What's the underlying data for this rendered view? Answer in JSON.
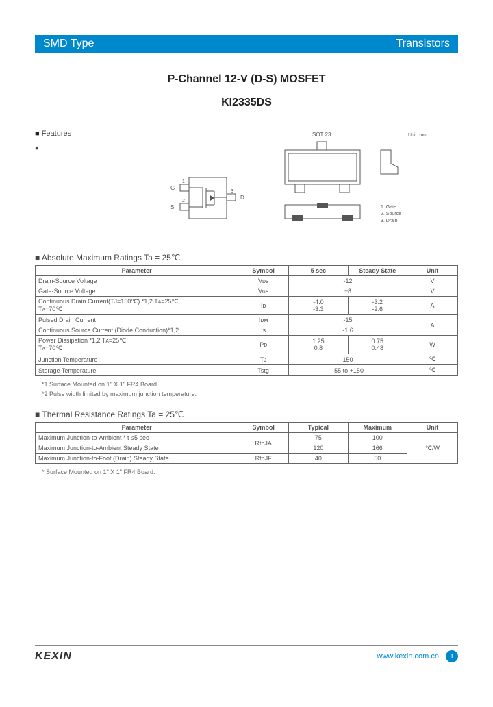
{
  "header": {
    "category": "SMD Type",
    "family": "Transistors"
  },
  "title": {
    "line1": "P-Channel 12-V (D-S) MOSFET",
    "part": "KI2335DS"
  },
  "features": {
    "heading": "Features"
  },
  "package": {
    "label": "SOT 23",
    "unitnote": "Unit: mm",
    "pins": {
      "p1": "1. Gate",
      "p2": "2. Source",
      "p3": "3. Drain"
    },
    "pinlabels": {
      "g": "G",
      "s": "S",
      "d": "D",
      "n1": "1",
      "n2": "2",
      "n3": "3"
    }
  },
  "abs": {
    "heading": "Absolute Maximum Ratings Ta = 25℃",
    "cols": {
      "param": "Parameter",
      "sym": "Symbol",
      "c5": "5 sec",
      "ss": "Steady State",
      "unit": "Unit"
    },
    "rows": [
      {
        "param": "Drain-Source Voltage",
        "sym": "Vᴅs",
        "c5": "",
        "val": "-12",
        "unit": "V",
        "merge": true
      },
      {
        "param": "Gate-Source Voltage",
        "sym": "Vɢs",
        "c5": "",
        "val": "±8",
        "unit": "V",
        "merge": true
      },
      {
        "param": "Continuous Drain Current(TJ=150℃) *1,2 Tᴀ=25℃\n                                                                          Tᴀ=70℃",
        "sym": "Iᴅ",
        "c5": "-4.0\n-3.3",
        "ss": "-3.2\n-2.6",
        "unit": "A"
      },
      {
        "param": "Pulsed Drain Current",
        "sym": "Iᴅᴍ",
        "val": "-15",
        "unit": "A",
        "merge": true,
        "unitrowspan": 2
      },
      {
        "param": "Continuous Source Current (Diode Conduction)*1,2",
        "sym": "Is",
        "val": "-1.6",
        "merge": true
      },
      {
        "param": "Power Dissipation *1,2                          Tᴀ=25℃\n                                                                  Tᴀ=70℃",
        "sym": "Pᴅ",
        "c5": "1.25\n0.8",
        "ss": "0.75\n0.48",
        "unit": "W"
      },
      {
        "param": "Junction Temperature",
        "sym": "Tᴊ",
        "val": "150",
        "unit": "℃",
        "merge": true
      },
      {
        "param": "Storage Temperature",
        "sym": "Tstg",
        "val": "-55 to +150",
        "unit": "℃",
        "merge": true
      }
    ],
    "note1": "*1 Surface Mounted on 1\" X 1\" FR4 Board.",
    "note2": "*2 Pulse width limited by maximum junction temperature."
  },
  "thermal": {
    "heading": "Thermal Resistance Ratings Ta = 25℃",
    "cols": {
      "param": "Parameter",
      "sym": "Symbol",
      "typ": "Typical",
      "max": "Maximum",
      "unit": "Unit"
    },
    "rows": [
      {
        "param": "Maximum Junction-to-Ambient *        t ≤5 sec",
        "sym": "RthJA",
        "typ": "75",
        "max": "100",
        "unit": "℃/W"
      },
      {
        "param": "Maximum Junction-to-Ambient        Steady State",
        "typ": "120",
        "max": "166"
      },
      {
        "param": "Maximum Junction-to-Foot (Drain)    Steady State",
        "sym": "RthJF",
        "typ": "40",
        "max": "50"
      }
    ],
    "note": "* Surface Mounted on 1\" X 1\" FR4 Board."
  },
  "footer": {
    "brand": "KEXIN",
    "url": "www.kexin.com.cn",
    "page": "1"
  }
}
